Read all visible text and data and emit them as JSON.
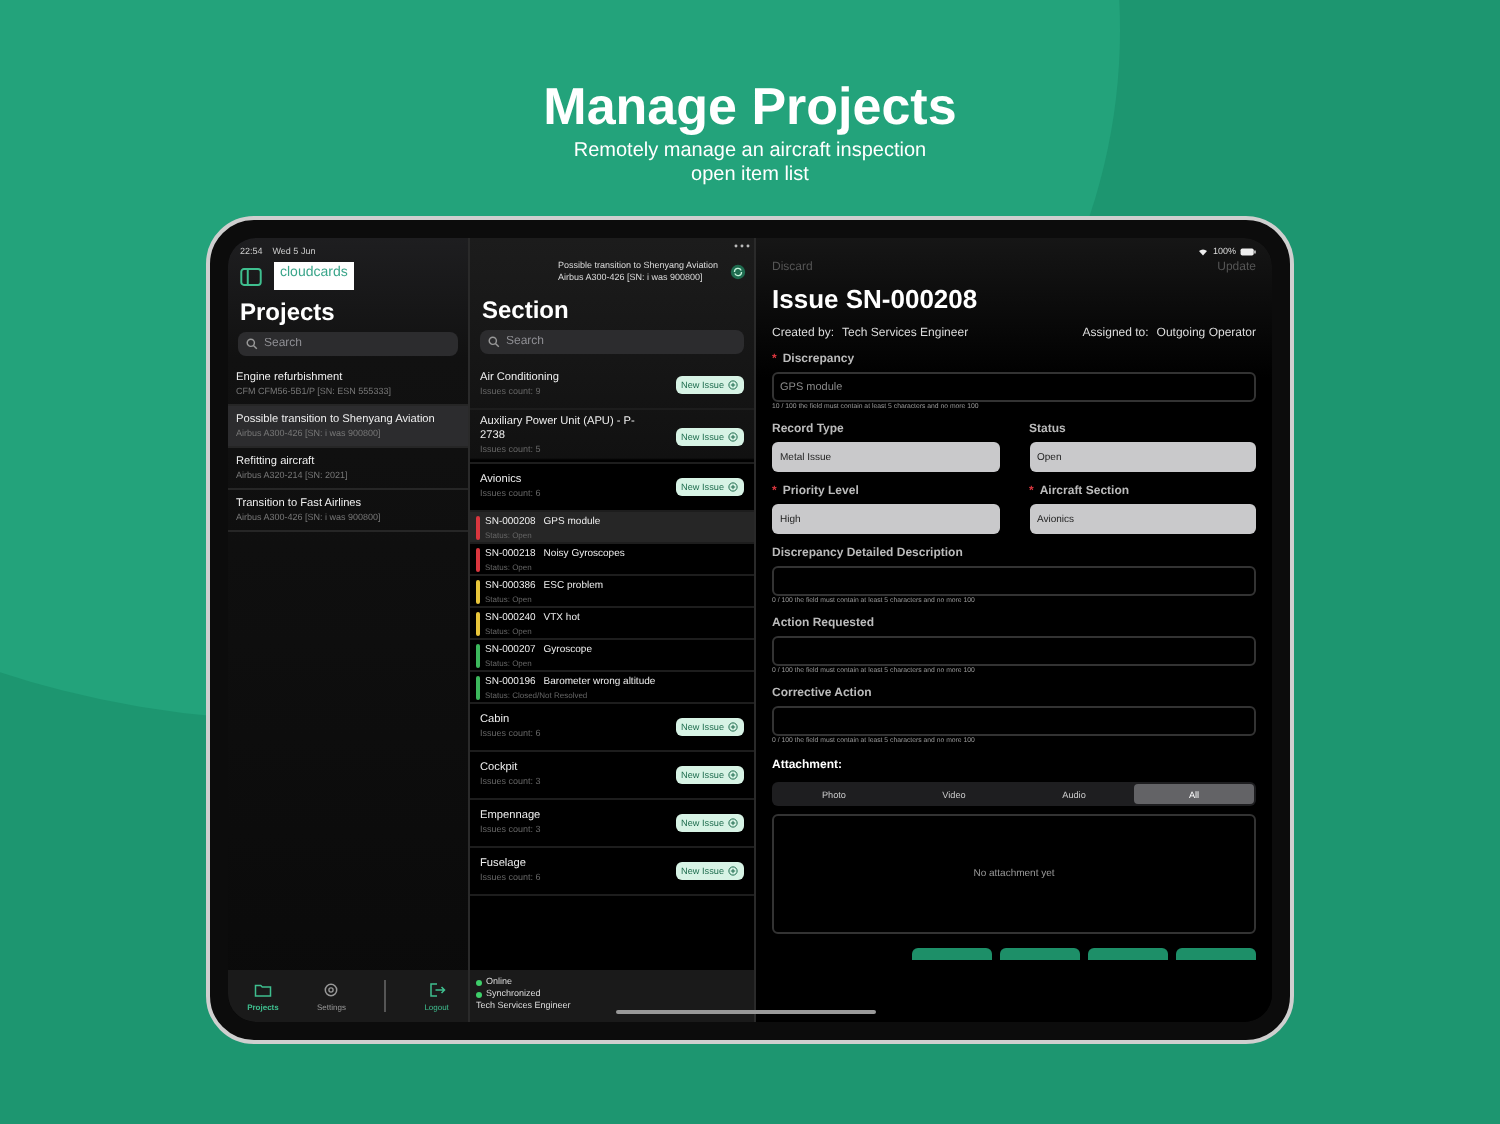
{
  "header": {
    "title": "Manage Projects",
    "subtitle": "Remotely manage an aircraft inspection open item list"
  },
  "status_bar": {
    "time": "22:54",
    "date": "Wed 5 Jun",
    "battery": "100%"
  },
  "projects_panel": {
    "logo": "cloudcards",
    "title": "Projects",
    "search": {
      "placeholder": "Search"
    },
    "items": [
      {
        "title": "Engine refurbishment",
        "subtitle": "CFM CFM56-5B1/P [SN: ESN 555333]",
        "selected": false
      },
      {
        "title": "Possible transition to Shenyang Aviation",
        "subtitle": "Airbus A300-426 [SN: i was 900800]",
        "selected": true
      },
      {
        "title": "Refitting aircraft",
        "subtitle": "Airbus A320-214  [SN: 2021]",
        "selected": false
      },
      {
        "title": "Transition to Fast Airlines",
        "subtitle": "Airbus A300-426 [SN: i was 900800]",
        "selected": false
      }
    ],
    "tabs": [
      {
        "label": "Projects",
        "kind": "folder",
        "selected": true
      },
      {
        "label": "Settings",
        "kind": "gear",
        "selected": false
      },
      {
        "label": "Logout",
        "kind": "logout",
        "selected": false
      }
    ]
  },
  "section_panel": {
    "context_title": "Possible transition to Shenyang Aviation",
    "context_subtitle": "Airbus A300-426 [SN: i was 900800]",
    "title": "Section",
    "search": {
      "placeholder": "Search"
    },
    "sections": [
      {
        "name": "Air Conditioning",
        "count": "Issues count: 9",
        "button": "New Issue"
      },
      {
        "name": "Auxiliary Power Unit (APU) - P-2738",
        "count": "Issues count: 5",
        "button": "New Issue"
      },
      {
        "name": "Avionics",
        "count": "Issues count: 6",
        "button": "New Issue",
        "issues": [
          {
            "id": "SN-000208",
            "title": "GPS module",
            "status": "Status: Open",
            "color": "#d9363e",
            "selected": true
          },
          {
            "id": "SN-000218",
            "title": "Noisy Gyroscopes",
            "status": "Status: Open",
            "color": "#d9363e",
            "selected": false
          },
          {
            "id": "SN-000386",
            "title": "ESC problem",
            "status": "Status: Open",
            "color": "#e8c53a",
            "selected": false
          },
          {
            "id": "SN-000240",
            "title": "VTX hot",
            "status": "Status: Open",
            "color": "#e8c53a",
            "selected": false
          },
          {
            "id": "SN-000207",
            "title": "Gyroscope",
            "status": "Status: Open",
            "color": "#3cb85c",
            "selected": false
          },
          {
            "id": "SN-000196",
            "title": "Barometer wrong altitude",
            "status": "Status: Closed/Not Resolved",
            "color": "#3cb85c",
            "selected": false
          }
        ]
      },
      {
        "name": "Cabin",
        "count": "Issues count: 6",
        "button": "New Issue"
      },
      {
        "name": "Cockpit",
        "count": "Issues count: 3",
        "button": "New Issue"
      },
      {
        "name": "Empennage",
        "count": "Issues count: 3",
        "button": "New Issue"
      },
      {
        "name": "Fuselage",
        "count": "Issues count: 6",
        "button": "New Issue"
      }
    ],
    "footer": {
      "statuses": [
        {
          "label": "Online",
          "color": "#3ecf6a"
        },
        {
          "label": "Synchronized",
          "color": "#3ecf6a"
        }
      ],
      "user": "Tech Services Engineer"
    }
  },
  "detail": {
    "discard": "Discard",
    "update": "Update",
    "title": "Issue SN-000208",
    "created_label": "Created by:",
    "created_by": "Tech Services Engineer",
    "assigned_label": "Assigned to:",
    "assigned_to": "Outgoing Operator",
    "rows": [
      {
        "kind": "text",
        "fields": [
          {
            "label": "Discrepancy",
            "required_mark": "*",
            "value": "GPS module",
            "hint": "10 / 100 the field must contain at least 5 characters and no more 100"
          }
        ]
      },
      {
        "kind": "select",
        "fields": [
          {
            "label": "Record Type",
            "value": "Metal Issue"
          },
          {
            "label": "Status",
            "value": "Open"
          }
        ]
      },
      {
        "kind": "select",
        "fields": [
          {
            "label": "Priority Level",
            "required_mark": "*",
            "value": "High"
          },
          {
            "label": "Aircraft Section",
            "required_mark": "*",
            "value": "Avionics"
          }
        ]
      },
      {
        "kind": "text",
        "fields": [
          {
            "label": "Discrepancy Detailed Description",
            "hint": "0 / 100 the field must contain at least 5 characters and no more 100"
          }
        ]
      },
      {
        "kind": "text",
        "fields": [
          {
            "label": "Action Requested",
            "hint": "0 / 100 the field must contain at least 5 characters and no more 100"
          }
        ]
      },
      {
        "kind": "text",
        "fields": [
          {
            "label": "Corrective Action",
            "hint": "0 / 100 the field must contain at least 5 characters and no more 100"
          }
        ]
      }
    ],
    "attachment": {
      "label": "Attachment:",
      "tabs": [
        {
          "label": "Photo",
          "selected": false
        },
        {
          "label": "Video",
          "selected": false
        },
        {
          "label": "Audio",
          "selected": false
        },
        {
          "label": "All",
          "selected": true
        }
      ],
      "empty": "No attachment yet"
    }
  }
}
